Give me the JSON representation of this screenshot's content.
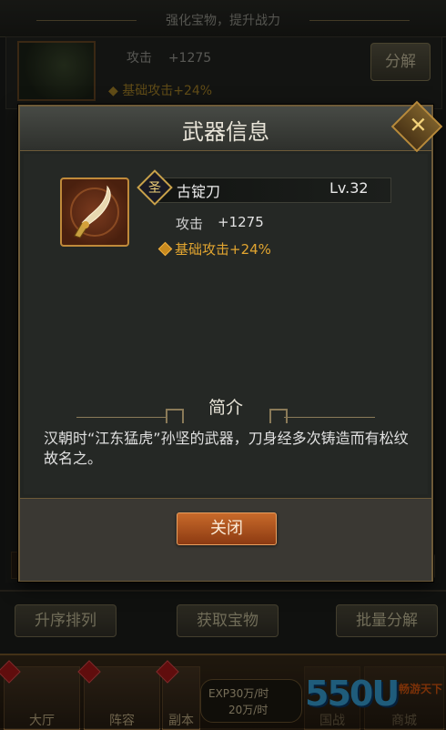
{
  "background": {
    "header_title": "强化宝物，提升战力",
    "row": {
      "stat_label": "攻击",
      "stat_value": "+1275",
      "bonus": "基础攻击+24%",
      "action": "分解"
    },
    "actions": [
      "升序排列",
      "获取宝物",
      "批量分解"
    ],
    "nav": [
      {
        "label": "大厅"
      },
      {
        "label": "阵容"
      },
      {
        "label": "副本"
      },
      {
        "label": "国战"
      },
      {
        "label": "商城"
      }
    ],
    "exp": {
      "line1": "EXP30万/时",
      "line2": "20万/时"
    },
    "logo": {
      "text": "550U",
      "sub": "畅游天下"
    }
  },
  "dialog": {
    "title": "武器信息",
    "weapon": {
      "grade": "圣",
      "name": "古锭刀",
      "level": "Lv.32",
      "stat_label": "攻击",
      "stat_value": "+1275",
      "bonus": "基础攻击+24%"
    },
    "section_title": "简介",
    "description": "汉朝时“江东猛虎”孙坚的武器，刀身经多次铸造而有松纹故名之。",
    "close_label": "关闭"
  },
  "colors": {
    "accent_gold": "#e2a530",
    "frame": "#6d5a38",
    "close_button": "#c86a2a"
  }
}
